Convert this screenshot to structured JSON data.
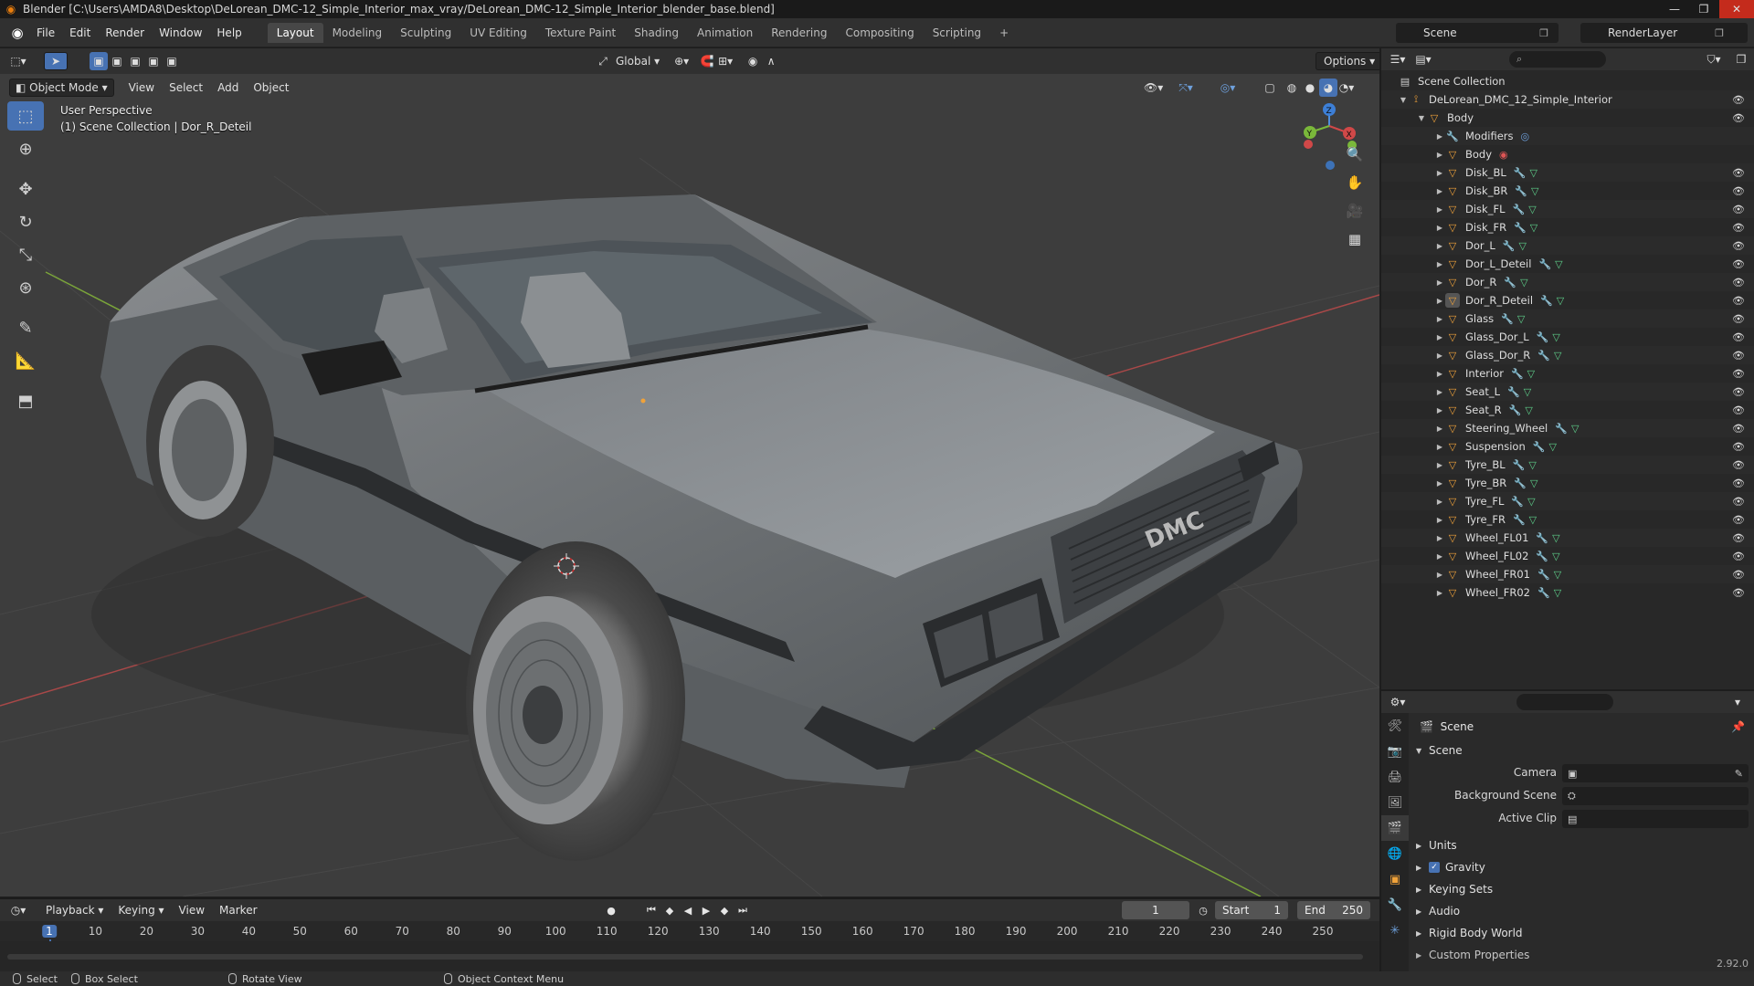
{
  "window": {
    "title": "Blender [C:\\Users\\AMDA8\\Desktop\\DeLorean_DMC-12_Simple_Interior_max_vray/DeLorean_DMC-12_Simple_Interior_blender_base.blend]"
  },
  "menubar": {
    "items": [
      "File",
      "Edit",
      "Render",
      "Window",
      "Help"
    ],
    "workspaces": [
      "Layout",
      "Modeling",
      "Sculpting",
      "UV Editing",
      "Texture Paint",
      "Shading",
      "Animation",
      "Rendering",
      "Compositing",
      "Scripting"
    ],
    "active_workspace": "Layout",
    "add_tab": "+",
    "scene": "Scene",
    "render_layer": "RenderLayer"
  },
  "viewport": {
    "transform_orientation": "Global",
    "options_label": "Options",
    "mode": "Object Mode",
    "menus": [
      "View",
      "Select",
      "Add",
      "Object"
    ],
    "info_line1": "User Perspective",
    "info_line2": "(1) Scene Collection | Dor_R_Deteil",
    "gizmo": {
      "x": "X",
      "y": "Y",
      "z": "Z"
    },
    "car_badge": "DMC"
  },
  "timeline": {
    "menus": [
      "Playback",
      "Keying",
      "View",
      "Marker"
    ],
    "current_frame": "1",
    "start_label": "Start",
    "start_value": "1",
    "end_label": "End",
    "end_value": "250",
    "ticks": [
      "1",
      "10",
      "20",
      "30",
      "40",
      "50",
      "60",
      "70",
      "80",
      "90",
      "100",
      "110",
      "120",
      "130",
      "140",
      "150",
      "160",
      "170",
      "180",
      "190",
      "200",
      "210",
      "220",
      "230",
      "240",
      "250"
    ]
  },
  "statusbar": {
    "select": "Select",
    "box_select": "Box Select",
    "rotate_view": "Rotate View",
    "context_menu": "Object Context Menu",
    "version": "2.92.0"
  },
  "outliner": {
    "root": "Scene Collection",
    "collection": "DeLorean_DMC_12_Simple_Interior",
    "parent": "Body",
    "items": [
      {
        "name": "Modifiers",
        "kind": "mod"
      },
      {
        "name": "Body",
        "kind": "mesh-data"
      },
      {
        "name": "Disk_BL",
        "kind": "obj"
      },
      {
        "name": "Disk_BR",
        "kind": "obj"
      },
      {
        "name": "Disk_FL",
        "kind": "obj"
      },
      {
        "name": "Disk_FR",
        "kind": "obj"
      },
      {
        "name": "Dor_L",
        "kind": "obj"
      },
      {
        "name": "Dor_L_Deteil",
        "kind": "obj"
      },
      {
        "name": "Dor_R",
        "kind": "obj"
      },
      {
        "name": "Dor_R_Deteil",
        "kind": "obj",
        "selected": true
      },
      {
        "name": "Glass",
        "kind": "obj"
      },
      {
        "name": "Glass_Dor_L",
        "kind": "obj"
      },
      {
        "name": "Glass_Dor_R",
        "kind": "obj"
      },
      {
        "name": "Interior",
        "kind": "obj"
      },
      {
        "name": "Seat_L",
        "kind": "obj"
      },
      {
        "name": "Seat_R",
        "kind": "obj"
      },
      {
        "name": "Steering_Wheel",
        "kind": "obj"
      },
      {
        "name": "Suspension",
        "kind": "obj"
      },
      {
        "name": "Tyre_BL",
        "kind": "obj"
      },
      {
        "name": "Tyre_BR",
        "kind": "obj"
      },
      {
        "name": "Tyre_FL",
        "kind": "obj"
      },
      {
        "name": "Tyre_FR",
        "kind": "obj"
      },
      {
        "name": "Wheel_FL01",
        "kind": "obj"
      },
      {
        "name": "Wheel_FL02",
        "kind": "obj"
      },
      {
        "name": "Wheel_FR01",
        "kind": "obj"
      },
      {
        "name": "Wheel_FR02",
        "kind": "obj"
      }
    ]
  },
  "properties": {
    "context": "Scene",
    "panel": "Scene",
    "camera_label": "Camera",
    "background_label": "Background Scene",
    "clip_label": "Active Clip",
    "sections": [
      "Units",
      "Gravity",
      "Keying Sets",
      "Audio",
      "Rigid Body World",
      "Custom Properties"
    ]
  },
  "colors": {
    "accent": "#4772b3",
    "object_icon": "#f0a23a",
    "modifier_icon": "#6ea0dc",
    "mesh_data_icon": "#5ecf8a"
  }
}
